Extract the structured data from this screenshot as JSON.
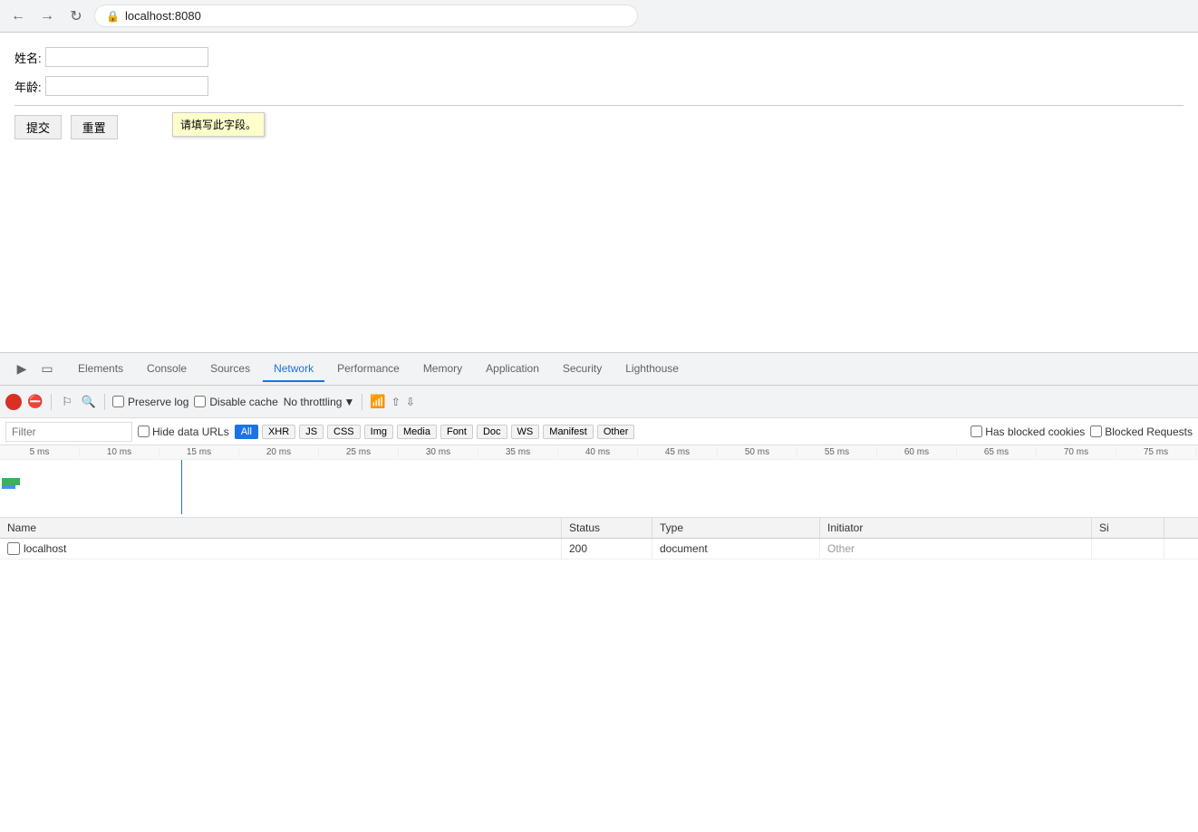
{
  "browser": {
    "url": "localhost:8080",
    "back_title": "Back",
    "forward_title": "Forward",
    "reload_title": "Reload"
  },
  "page": {
    "name_label": "姓名:",
    "age_label": "年龄:",
    "tooltip": "请填写此字段。",
    "submit_label": "提交",
    "reset_label": "重置"
  },
  "devtools": {
    "tabs": [
      {
        "id": "elements",
        "label": "Elements"
      },
      {
        "id": "console",
        "label": "Console"
      },
      {
        "id": "sources",
        "label": "Sources"
      },
      {
        "id": "network",
        "label": "Network",
        "active": true
      },
      {
        "id": "performance",
        "label": "Performance"
      },
      {
        "id": "memory",
        "label": "Memory"
      },
      {
        "id": "application",
        "label": "Application"
      },
      {
        "id": "security",
        "label": "Security"
      },
      {
        "id": "lighthouse",
        "label": "Lighthouse"
      }
    ],
    "network": {
      "toolbar": {
        "preserve_log_label": "Preserve log",
        "disable_cache_label": "Disable cache",
        "throttle_label": "No throttling"
      },
      "filter": {
        "placeholder": "Filter",
        "hide_data_urls_label": "Hide data URLs",
        "type_btns": [
          "All",
          "XHR",
          "JS",
          "CSS",
          "Img",
          "Media",
          "Font",
          "Doc",
          "WS",
          "Manifest",
          "Other"
        ],
        "active_type": "All",
        "has_blocked_label": "Has blocked cookies",
        "blocked_requests_label": "Blocked Requests"
      },
      "timeline": {
        "ticks": [
          "5 ms",
          "10 ms",
          "15 ms",
          "20 ms",
          "25 ms",
          "30 ms",
          "35 ms",
          "40 ms",
          "45 ms",
          "50 ms",
          "55 ms",
          "60 ms",
          "65 ms",
          "70 ms",
          "75 ms"
        ]
      },
      "table": {
        "headers": [
          "Name",
          "Status",
          "Type",
          "Initiator",
          "Si"
        ],
        "rows": [
          {
            "name": "localhost",
            "status": "200",
            "type": "document",
            "initiator": "Other",
            "size": ""
          }
        ]
      }
    }
  }
}
